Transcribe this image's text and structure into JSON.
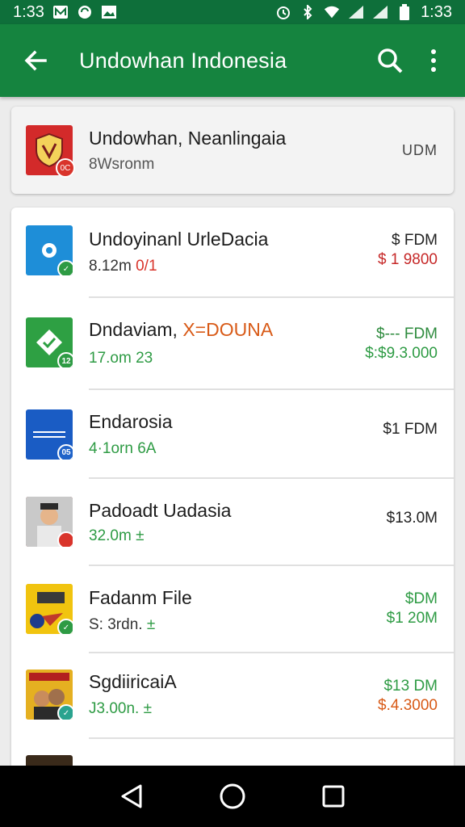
{
  "status_bar": {
    "time_left": "1:33",
    "time_right": "1:33",
    "left_icons": [
      "m-icon",
      "sync-icon",
      "image-icon"
    ],
    "right_icons": [
      "alarm-icon",
      "bluetooth-icon",
      "wifi-icon",
      "signal-icon",
      "signal-icon",
      "battery-icon"
    ]
  },
  "app_bar": {
    "title": "Undowhan Indonesia",
    "color": "#15843f"
  },
  "header_card": {
    "name": "Undowhan, Neanlingaia",
    "subtitle": "8Wsronm",
    "tag": "UDM",
    "badge": "0C"
  },
  "rows": [
    {
      "name": "Undoyinanl UrleDacia",
      "name_accent": "",
      "sub_main": "8.12m",
      "sub_extra": "0/1",
      "price_a": "$ FDM",
      "price_b": "$ 1 9800",
      "badge": "✓",
      "badge_color": "#2e9b44",
      "thumb_color": "#1e8ed8"
    },
    {
      "name": "Dndaviam, ",
      "name_accent": "X=DOUNA",
      "sub_main": "17.om 23",
      "sub_extra": "",
      "price_a": "$--- FDM",
      "price_b": "$:$9.3.000",
      "badge": "12",
      "badge_color": "#2e9b44",
      "thumb_color": "#2ea043"
    },
    {
      "name": "Endarosia",
      "name_accent": "",
      "sub_main": "4·1orn 6A",
      "sub_extra": "",
      "price_a": "$1 FDM",
      "price_b": "",
      "badge": "05",
      "badge_color": "#1f63c9",
      "thumb_color": "#1a5cc4"
    },
    {
      "name": "Padoadt Uadasia",
      "name_accent": "",
      "sub_main": "32.0m",
      "sub_extra": "±",
      "price_a": "$13.0M",
      "price_b": "",
      "badge": "",
      "badge_color": "#d9342b",
      "thumb_color": "#8a2a2a"
    },
    {
      "name": "Fadanm File",
      "name_accent": "",
      "sub_main": "S: 3rdn.",
      "sub_extra": "±",
      "price_a": "$DM",
      "price_b": "$1 20M",
      "badge": "✓",
      "badge_color": "#2e9b44",
      "thumb_color": "#f1c40f"
    },
    {
      "name": "SgdiiricaiA",
      "name_accent": "",
      "sub_main": "J3.00n.",
      "sub_extra": "±",
      "price_a": "$13 DM",
      "price_b": "$.4.3000",
      "badge": "✓",
      "badge_color": "#2aa38f",
      "thumb_color": "#e5b021"
    }
  ],
  "nav_bar": {
    "buttons": [
      "back-triangle-icon",
      "home-circle-icon",
      "recents-square-icon"
    ]
  }
}
